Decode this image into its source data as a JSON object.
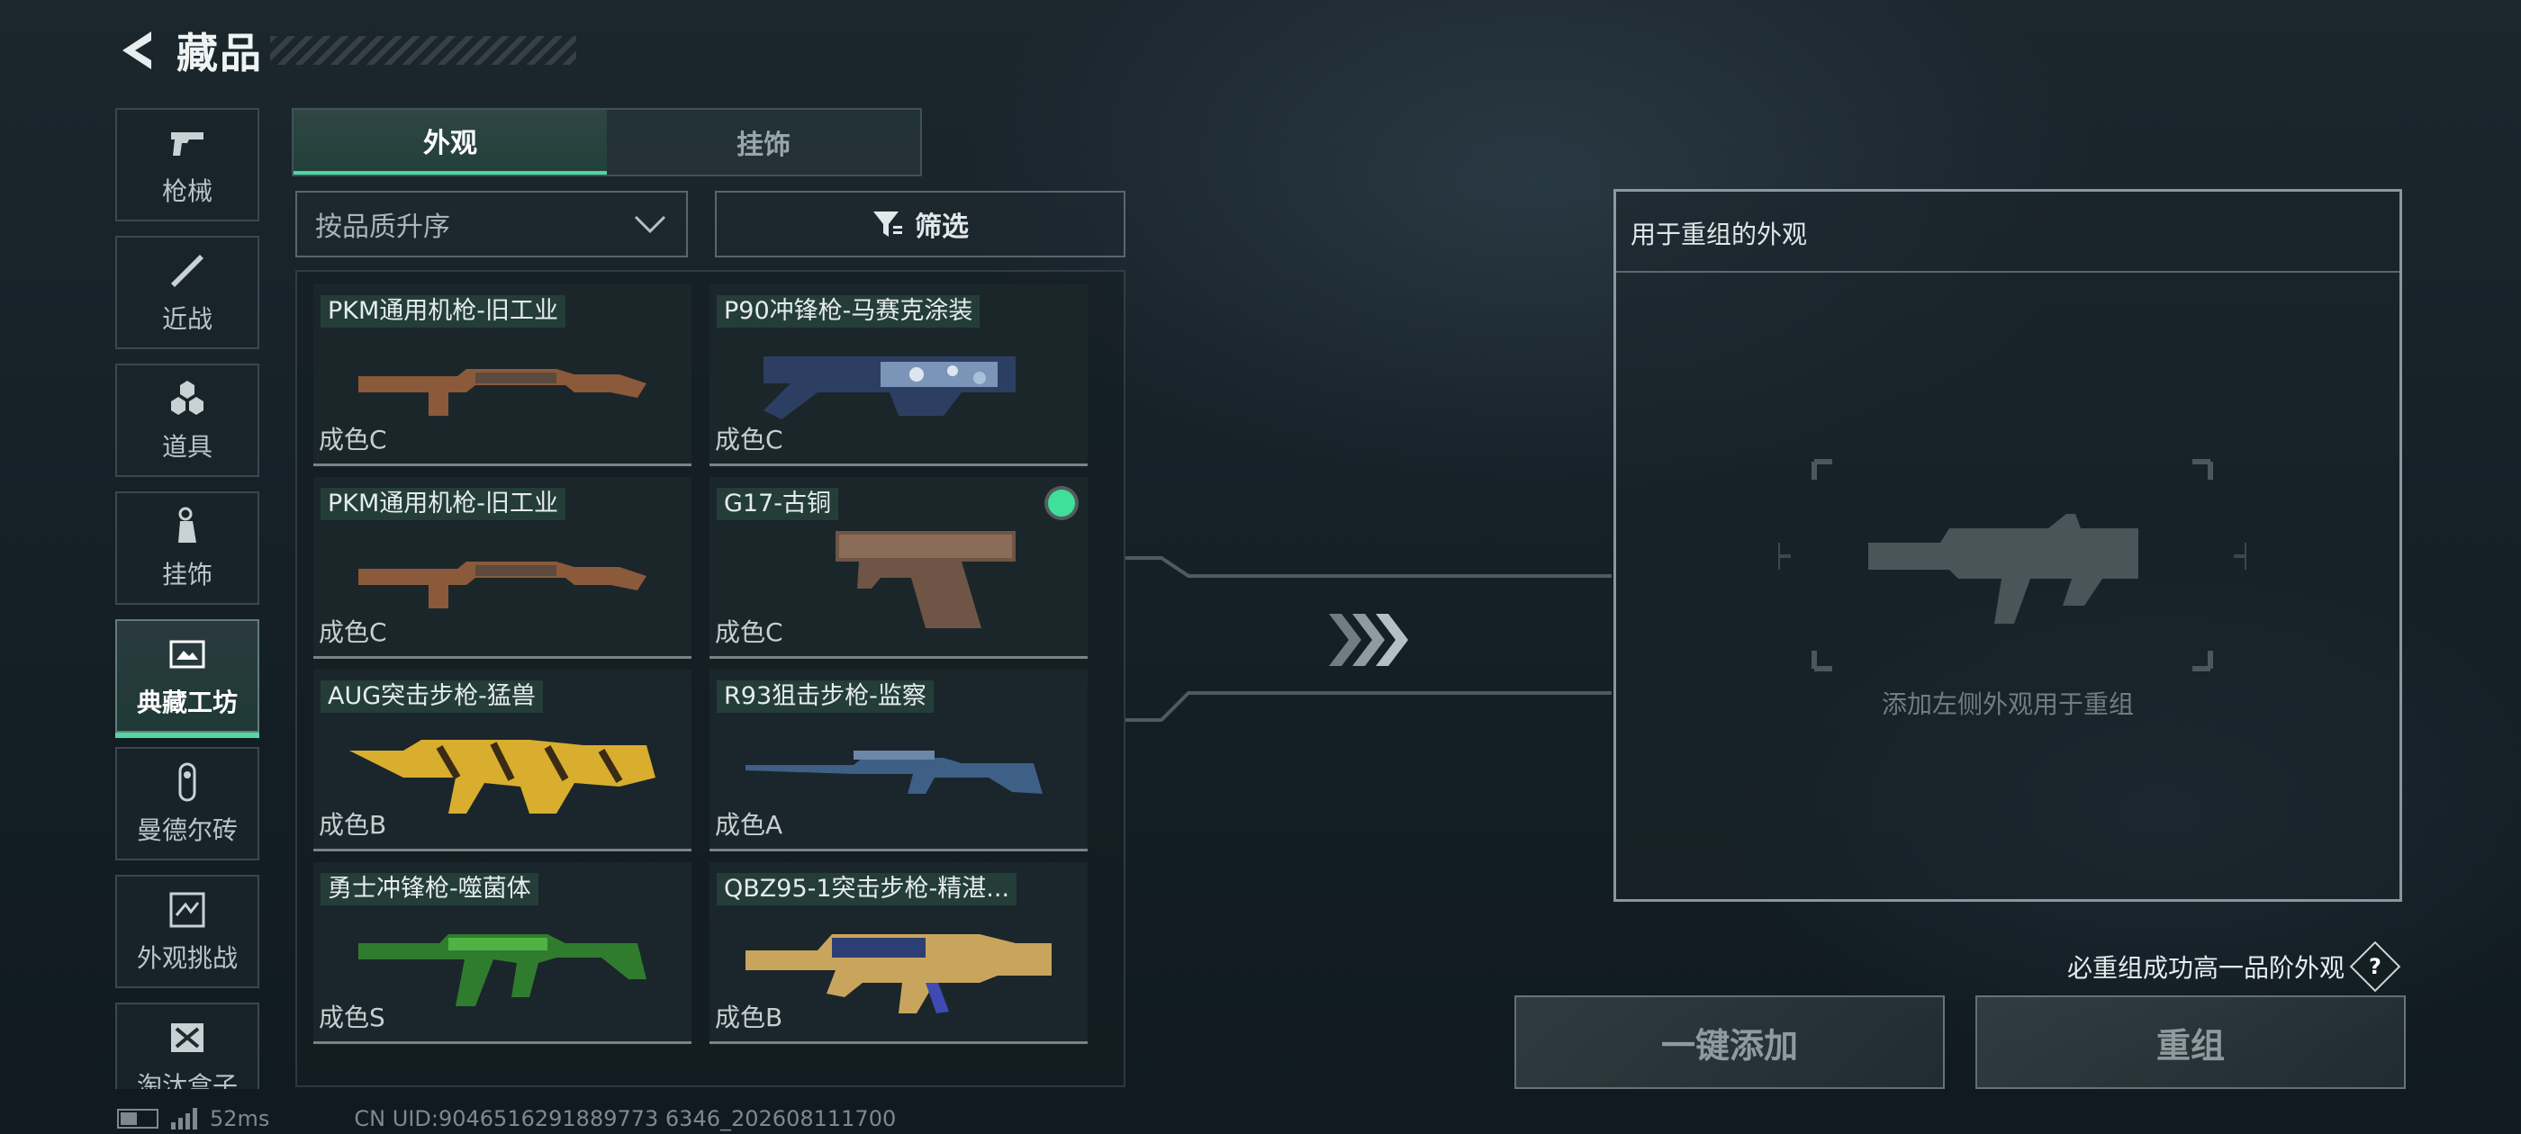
{
  "header": {
    "title": "藏品"
  },
  "categories": [
    {
      "label": "枪械",
      "icon": "pistol-icon"
    },
    {
      "label": "近战",
      "icon": "knife-icon"
    },
    {
      "label": "道具",
      "icon": "items-icon"
    },
    {
      "label": "挂饰",
      "icon": "charm-icon"
    },
    {
      "label": "典藏工坊",
      "icon": "workshop-icon",
      "active": true
    },
    {
      "label": "曼德尔砖",
      "icon": "mandel-brick-icon"
    },
    {
      "label": "外观挑战",
      "icon": "challenge-icon"
    },
    {
      "label": "淘汰盒子",
      "icon": "box-icon"
    }
  ],
  "tabs": [
    {
      "label": "外观",
      "active": true
    },
    {
      "label": "挂饰",
      "active": false
    }
  ],
  "sort": {
    "value": "按品质升序"
  },
  "filter": {
    "label": "筛选"
  },
  "skins": [
    {
      "name": "PKM通用机枪-旧工业",
      "grade": "成色C",
      "gun": "pkm"
    },
    {
      "name": "P90冲锋枪-马赛克涂装",
      "grade": "成色C",
      "gun": "p90"
    },
    {
      "name": "PKM通用机枪-旧工业",
      "grade": "成色C",
      "gun": "pkm"
    },
    {
      "name": "G17-古铜",
      "grade": "成色C",
      "gun": "g17",
      "selected": true
    },
    {
      "name": "AUG突击步枪-猛兽",
      "grade": "成色B",
      "gun": "aug"
    },
    {
      "name": "R93狙击步枪-监察",
      "grade": "成色A",
      "gun": "r93"
    },
    {
      "name": "勇士冲锋枪-噬菌体",
      "grade": "成色S",
      "gun": "smg"
    },
    {
      "name": "QBZ95-1突击步枪-精湛...",
      "grade": "成色B",
      "gun": "qbz"
    }
  ],
  "recombine": {
    "title": "用于重组的外观",
    "hint": "添加左侧外观用于重组",
    "guarantee": "必重组成功高一品阶外观",
    "add_all_label": "一键添加",
    "recombine_label": "重组"
  },
  "status": {
    "ping": "52ms",
    "uid": "CN UID:9046516291889773 6346_202608111700"
  },
  "colors": {
    "accent": "#4fd8a2",
    "selected": "#3ee09a"
  }
}
